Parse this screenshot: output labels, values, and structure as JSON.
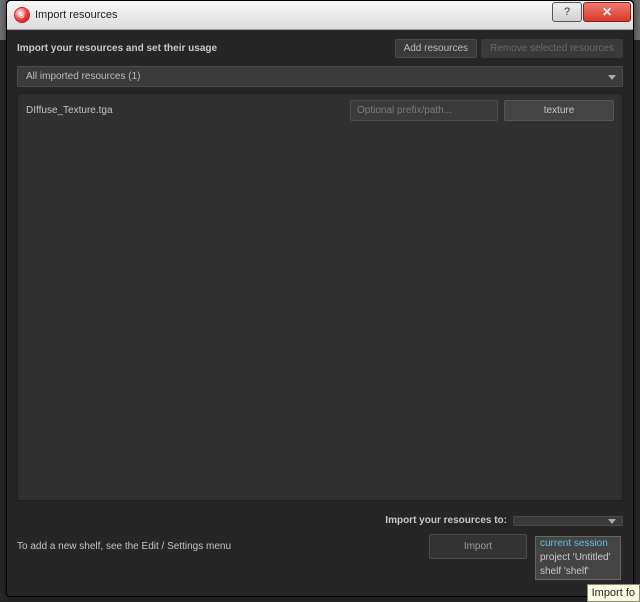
{
  "window": {
    "title": "Import resources"
  },
  "header": {
    "instruction": "Import your resources and set their usage",
    "add_btn": "Add resources",
    "remove_btn": "Remove selected resources"
  },
  "filter": {
    "label": "All imported resources (1)"
  },
  "rows": [
    {
      "name": "DIffuse_Texture.tga",
      "prefix_placeholder": "Optional prefix/path...",
      "type": "texture"
    }
  ],
  "footer": {
    "target_label": "Import your resources to:",
    "target_value": "",
    "hint": "To add a new shelf, see the Edit / Settings menu",
    "import_btn": "Import"
  },
  "dropdown": {
    "opt1": "current session",
    "opt2": "project 'Untitled'",
    "opt3": "shelf 'shelf'"
  },
  "tooltip": "Import fo"
}
